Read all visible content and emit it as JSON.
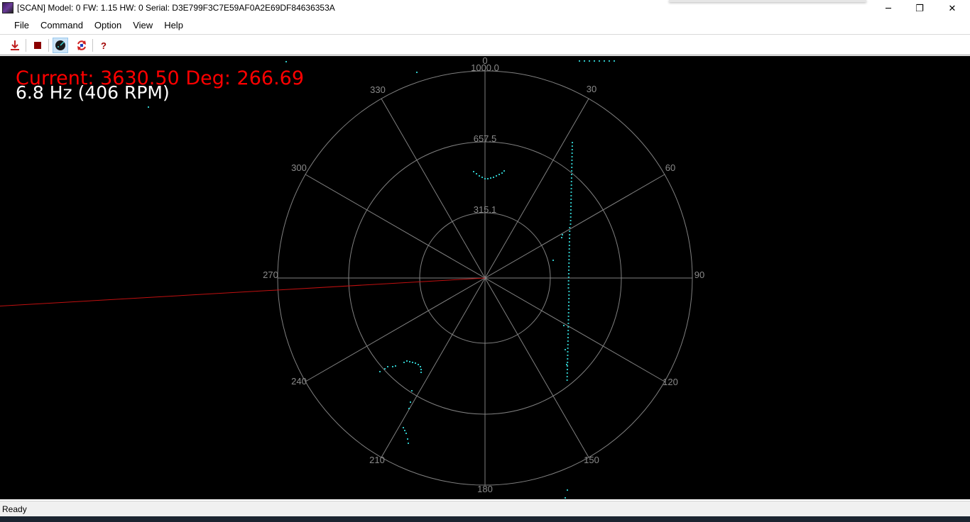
{
  "window": {
    "title": "[SCAN] Model: 0 FW: 1.15 HW: 0 Serial: D3E799F3C7E59AF0A2E69DF84636353A",
    "minimize_glyph": "─",
    "restore_glyph": "❐",
    "close_glyph": "✕"
  },
  "menu": {
    "items": [
      "File",
      "Command",
      "Option",
      "View",
      "Help"
    ]
  },
  "toolbar": {
    "help_label": "?",
    "icons": [
      "download-icon",
      "stop-icon",
      "scan-view-icon",
      "refresh-icon",
      "help-icon"
    ]
  },
  "readout": {
    "current": "Current: 3630.50 Deg: 266.69",
    "frequency": "6.8 Hz (406 RPM)"
  },
  "polar": {
    "range_labels": [
      "315.1",
      "657.5",
      "1000.0"
    ],
    "angle_labels": [
      "0",
      "30",
      "60",
      "90",
      "120",
      "150",
      "180",
      "210",
      "240",
      "270",
      "300",
      "330"
    ],
    "scan_heading_deg": 266.69,
    "colors": {
      "grid": "#808080",
      "points": "#2ec4c4",
      "heading": "#c01010",
      "current_text": "#ff0000",
      "freq_text": "#ffffff"
    }
  },
  "status": {
    "text": "Ready"
  }
}
